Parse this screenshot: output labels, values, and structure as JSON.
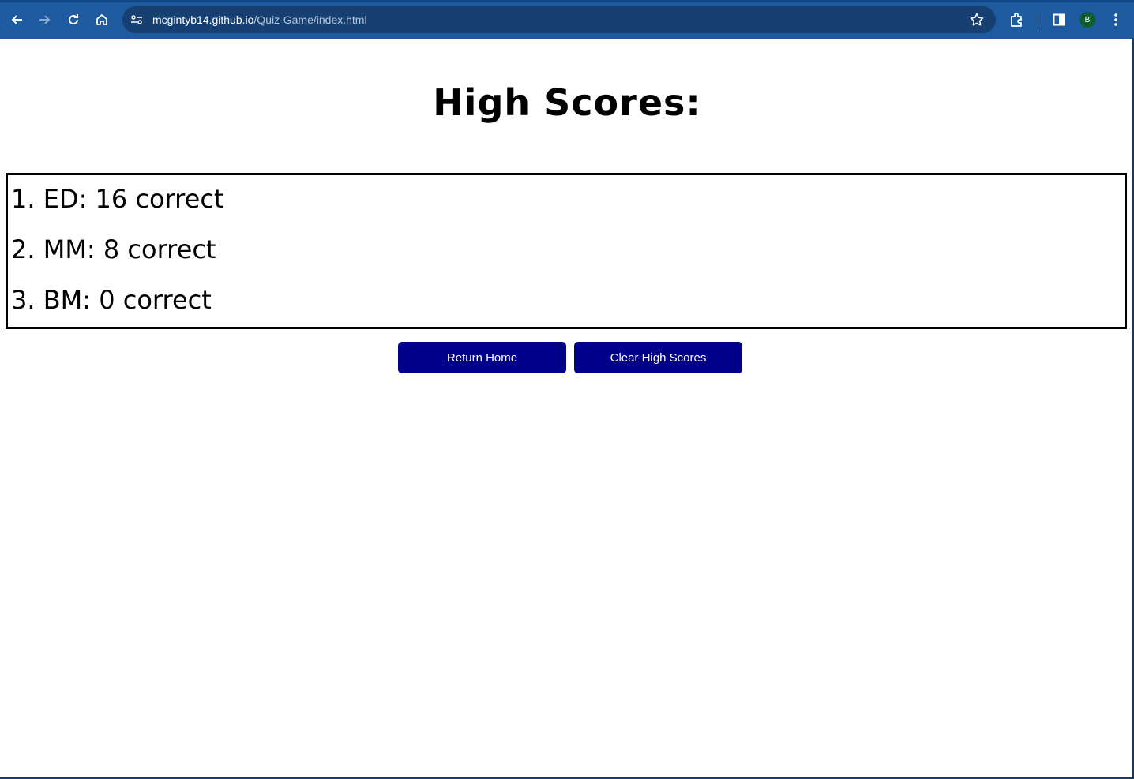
{
  "browser": {
    "url_host": "mcgintyb14.github.io",
    "url_path": "/Quiz-Game/index.html",
    "profile_initial": "B",
    "colors": {
      "toolbar": "#1d5aa0",
      "omnibox": "#163f72",
      "avatar": "#0c5e2c"
    },
    "icons": [
      "back-arrow-icon",
      "forward-arrow-icon",
      "reload-icon",
      "home-icon",
      "site-info-icon",
      "bookmark-star-icon",
      "extensions-puzzle-icon",
      "side-panel-icon",
      "more-vert-icon"
    ]
  },
  "page": {
    "title": "High Scores:",
    "scores": [
      "1. ED: 16 correct",
      "2. MM: 8 correct",
      "3. BM: 0 correct"
    ],
    "buttons": {
      "return_home": "Return Home",
      "clear_scores": "Clear High Scores"
    },
    "colors": {
      "button_bg": "#00008b",
      "button_text": "#ffffff",
      "border": "#000000"
    }
  }
}
